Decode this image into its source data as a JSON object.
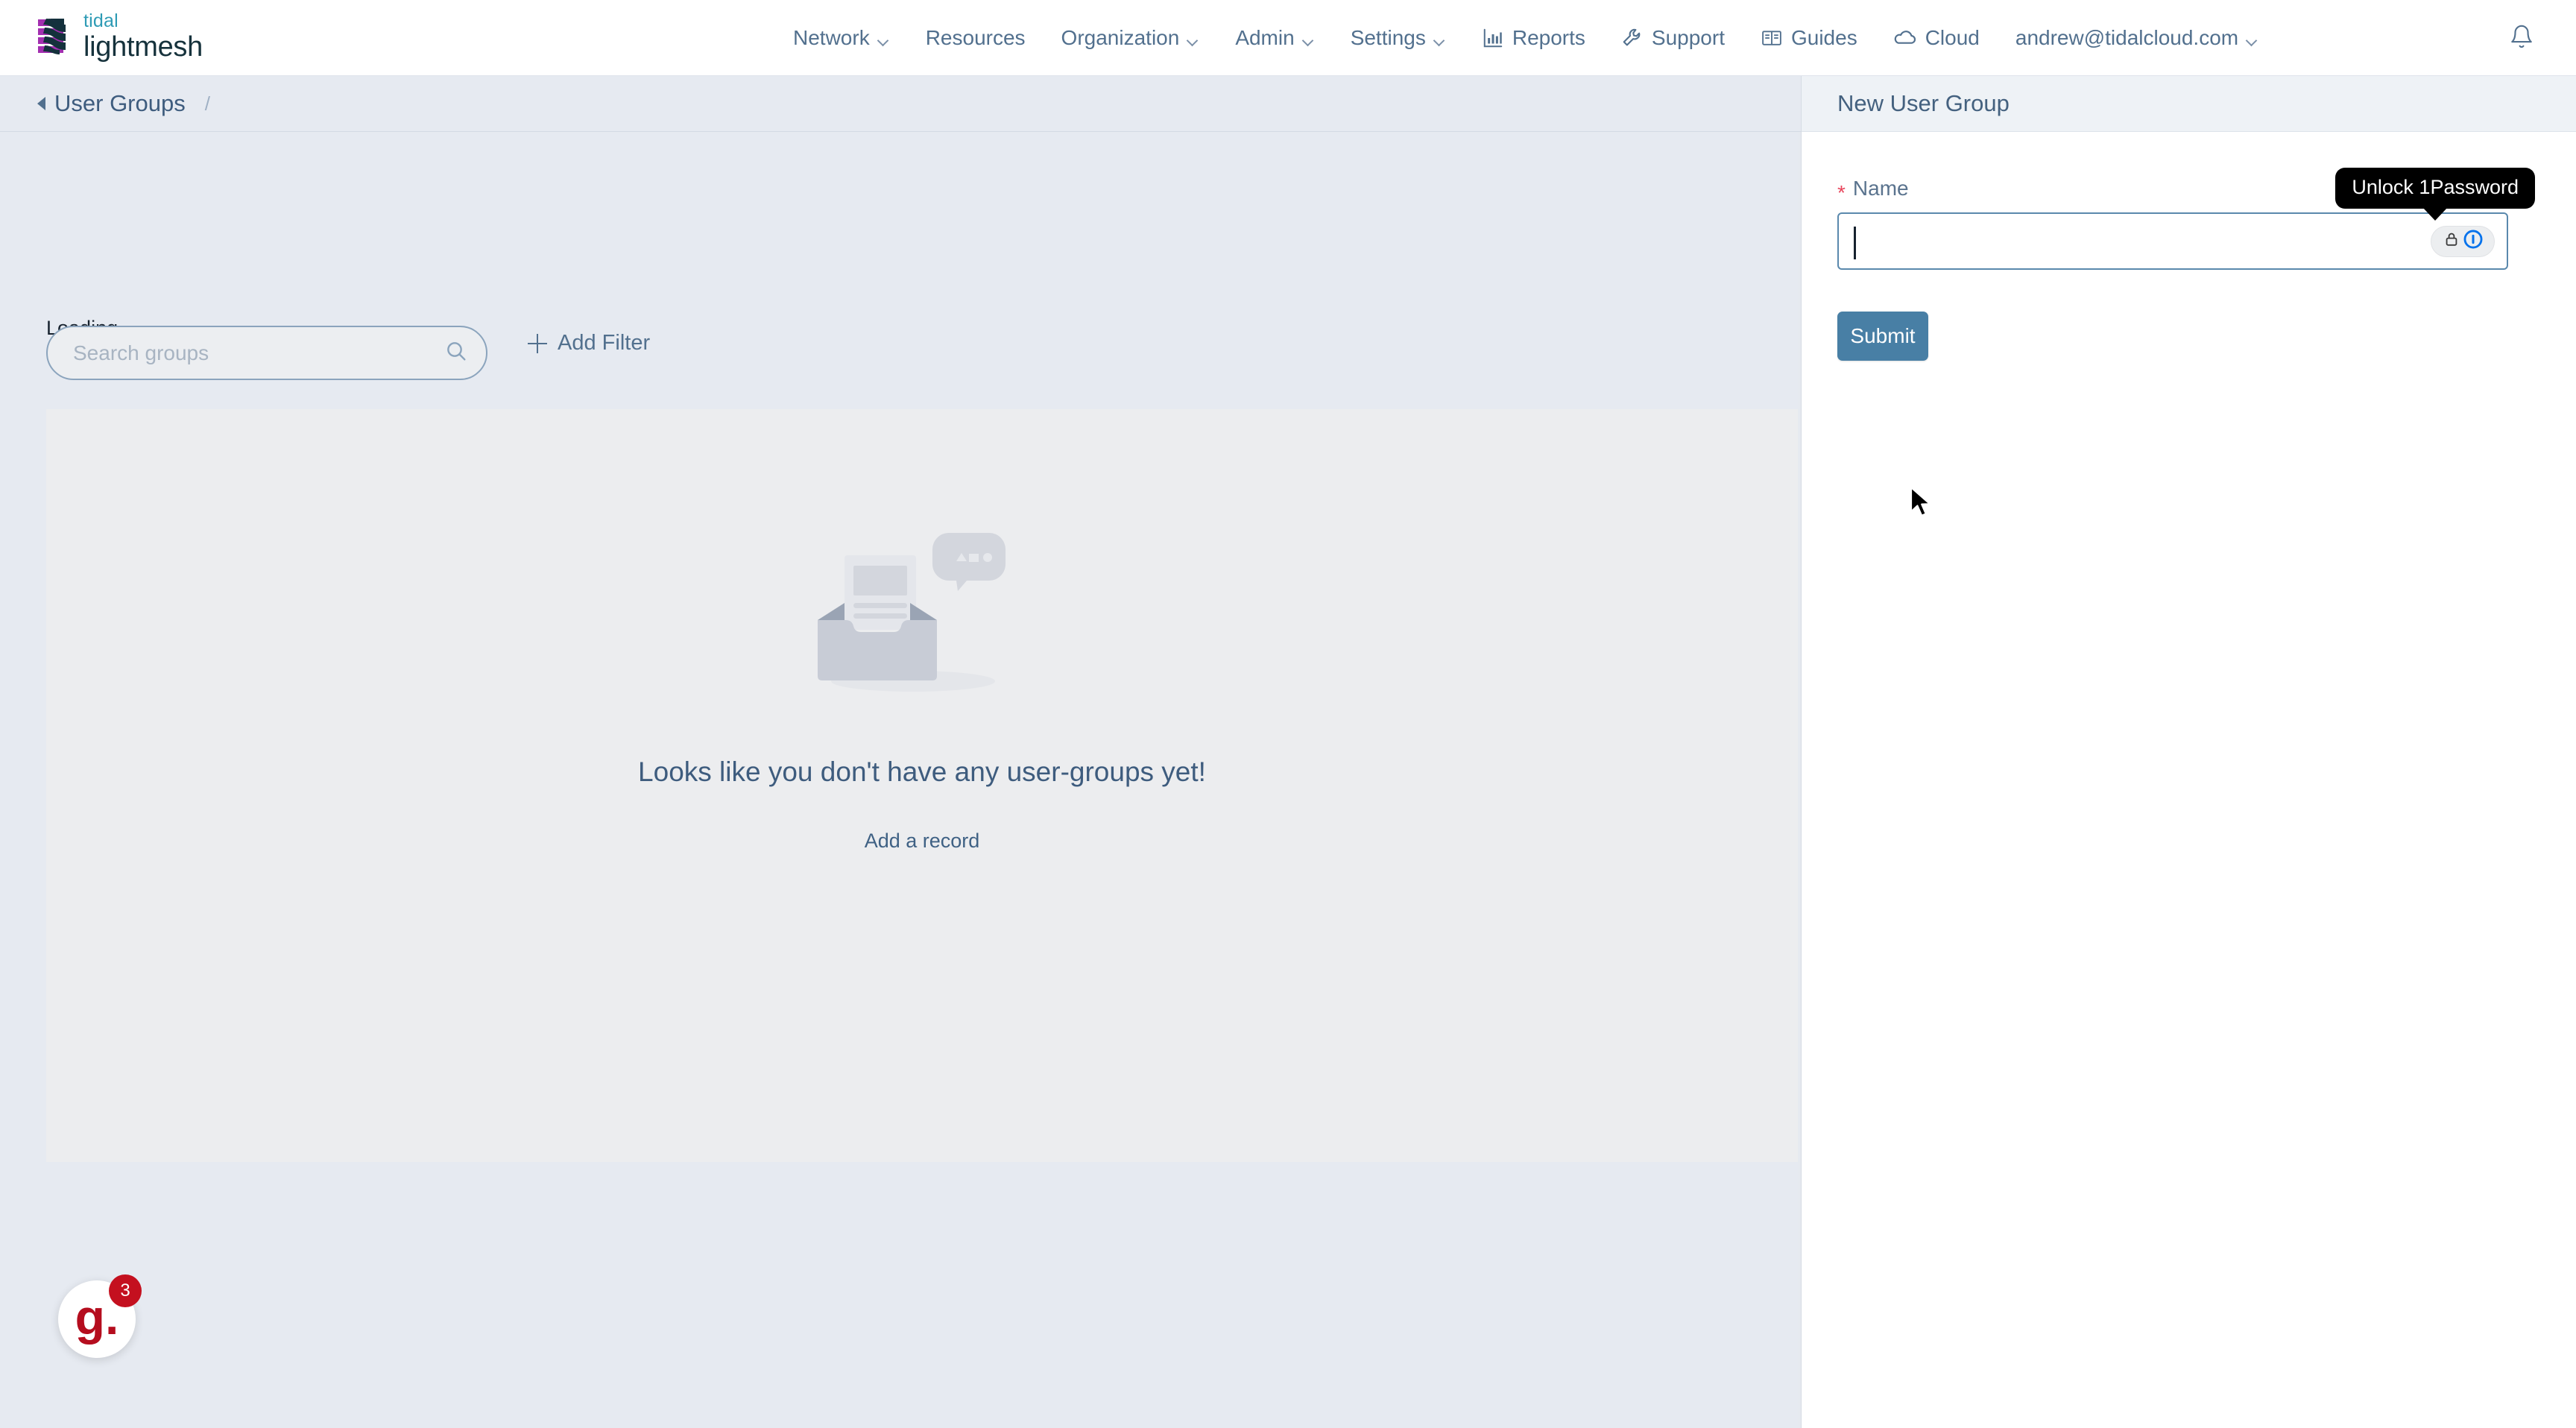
{
  "brand": {
    "top_word": "tidal",
    "bottom_word": "lightmesh",
    "mark_icon": "lightmesh-logo-icon",
    "accent_purple": "#a32fb0",
    "accent_dark": "#14313c",
    "accent_teal": "#2e9bb5"
  },
  "topnav": {
    "items": [
      {
        "label": "Network",
        "has_chevron": true,
        "icon": null
      },
      {
        "label": "Resources",
        "has_chevron": false,
        "icon": null
      },
      {
        "label": "Organization",
        "has_chevron": true,
        "icon": null
      },
      {
        "label": "Admin",
        "has_chevron": true,
        "icon": null
      },
      {
        "label": "Settings",
        "has_chevron": true,
        "icon": null
      },
      {
        "label": "Reports",
        "has_chevron": false,
        "icon": "bar-chart-icon"
      },
      {
        "label": "Support",
        "has_chevron": false,
        "icon": "wrench-icon"
      },
      {
        "label": "Guides",
        "has_chevron": false,
        "icon": "book-icon"
      },
      {
        "label": "Cloud",
        "has_chevron": false,
        "icon": "cloud-icon"
      },
      {
        "label": "andrew@tidalcloud.com",
        "has_chevron": true,
        "icon": null
      }
    ],
    "notifications_icon": "bell-icon",
    "link_color": "#52708e"
  },
  "breadcrumb": {
    "back_icon": "back-arrow-icon",
    "title": "User Groups",
    "separator": "/"
  },
  "toolbar": {
    "loading_text": "Loading...",
    "search_placeholder": "Search groups",
    "search_value": "",
    "search_icon": "search-icon",
    "add_filter_label": "Add Filter",
    "add_filter_icon": "plus-icon"
  },
  "empty_state": {
    "illustration": "empty-inbox-illustration",
    "title": "Looks like you don't have any user-groups yet!",
    "link_label": "Add a record",
    "title_color": "#3e5c7e"
  },
  "drawer": {
    "title": "New User Group",
    "field": {
      "required_marker": "*",
      "label": "Name",
      "value": "",
      "placeholder": ""
    },
    "password_manager": {
      "tooltip": "Unlock 1Password",
      "lock_icon": "lock-icon",
      "brand_icon": "onepassword-icon",
      "brand_color": "#0572ec"
    },
    "submit_label": "Submit",
    "submit_color": "#487fa5"
  },
  "help_widget": {
    "logo_text": "g.",
    "badge_count": "3",
    "logo_color": "#b50d1e",
    "badge_color": "#c4101f"
  }
}
